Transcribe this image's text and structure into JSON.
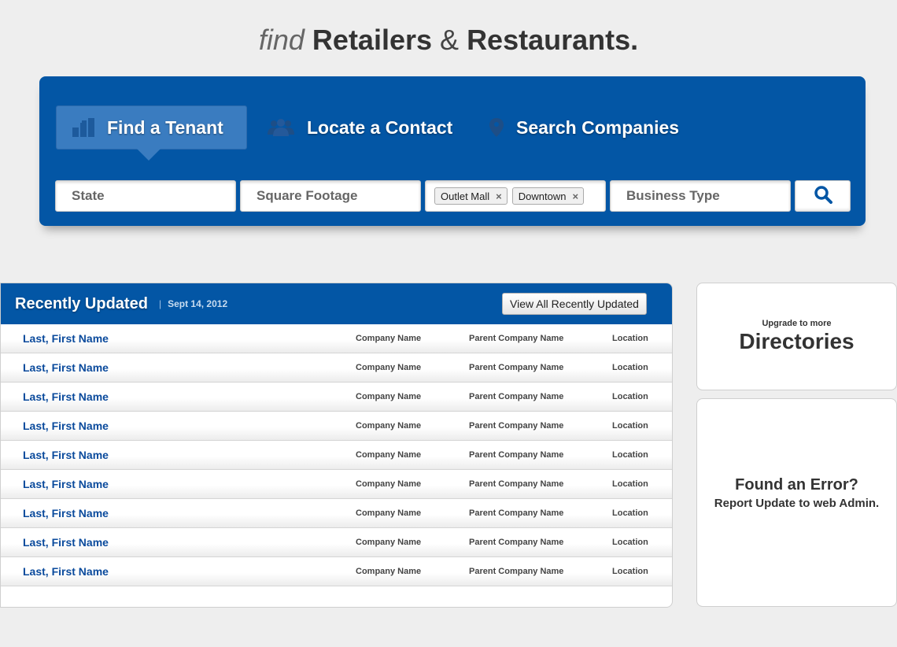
{
  "headline": {
    "find": "find",
    "retailers": "Retailers",
    "amp": "&",
    "restaurants": "Restaurants."
  },
  "tabs": [
    {
      "label": "Find a Tenant",
      "icon": "building-icon",
      "active": true
    },
    {
      "label": "Locate a Contact",
      "icon": "people-icon",
      "active": false
    },
    {
      "label": "Search Companies",
      "icon": "map-pin-icon",
      "active": false
    }
  ],
  "search": {
    "state_placeholder": "State",
    "sqft_placeholder": "Square Footage",
    "tags": [
      "Outlet Mall",
      "Downtown"
    ],
    "tag_remove": "×",
    "business_type_placeholder": "Business Type",
    "button_icon": "search-icon"
  },
  "recent": {
    "title": "Recently Updated",
    "separator": "|",
    "date": "Sept 14, 2012",
    "view_all_label": "View All Recently Updated",
    "rows": [
      {
        "name": "Last, First Name",
        "company": "Company Name",
        "parent": "Parent Company Name",
        "location": "Location"
      },
      {
        "name": "Last, First Name",
        "company": "Company Name",
        "parent": "Parent Company Name",
        "location": "Location"
      },
      {
        "name": "Last, First Name",
        "company": "Company Name",
        "parent": "Parent Company Name",
        "location": "Location"
      },
      {
        "name": "Last, First Name",
        "company": "Company Name",
        "parent": "Parent Company Name",
        "location": "Location"
      },
      {
        "name": "Last, First Name",
        "company": "Company Name",
        "parent": "Parent Company Name",
        "location": "Location"
      },
      {
        "name": "Last, First Name",
        "company": "Company Name",
        "parent": "Parent Company Name",
        "location": "Location"
      },
      {
        "name": "Last, First Name",
        "company": "Company Name",
        "parent": "Parent Company Name",
        "location": "Location"
      },
      {
        "name": "Last, First Name",
        "company": "Company Name",
        "parent": "Parent Company Name",
        "location": "Location"
      },
      {
        "name": "Last, First Name",
        "company": "Company Name",
        "parent": "Parent Company Name",
        "location": "Location"
      }
    ]
  },
  "upgrade": {
    "small": "Upgrade to more",
    "big": "Directories"
  },
  "error_card": {
    "title": "Found an Error?",
    "subtitle": "Report Update to web Admin."
  },
  "colors": {
    "brand_blue": "#0356a5",
    "active_tab": "#3a7cc0",
    "link_blue": "#0a4a9c",
    "background": "#eeeeee"
  }
}
